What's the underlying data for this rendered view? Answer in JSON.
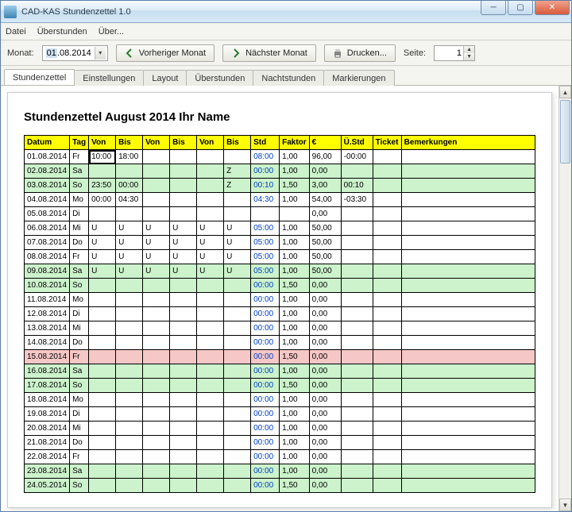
{
  "window": {
    "title": "CAD-KAS Stundenzettel 1.0"
  },
  "menu": {
    "items": [
      "Datei",
      "Überstunden",
      "Über..."
    ]
  },
  "toolbar": {
    "month_label": "Monat:",
    "date_value": "01.08.2014",
    "date_sel": "01",
    "date_rest": ".08.2014",
    "prev": "Vorheriger Monat",
    "next": "Nächster Monat",
    "print": "Drucken...",
    "page_label": "Seite:",
    "page_value": "1"
  },
  "tabs": [
    "Stundenzettel",
    "Einstellungen",
    "Layout",
    "Überstunden",
    "Nachtstunden",
    "Markierungen"
  ],
  "active_tab": 0,
  "sheet": {
    "title": "Stundenzettel August 2014 Ihr Name",
    "columns": [
      "Datum",
      "Tag",
      "Von",
      "Bis",
      "Von",
      "Bis",
      "Von",
      "Bis",
      "Std",
      "Faktor",
      "€",
      "Ü.Std",
      "Ticket",
      "Bemerkungen"
    ],
    "rows": [
      {
        "date": "01.08.2014",
        "tag": "Fr",
        "v1": "10:00",
        "b1": "18:00",
        "v2": "",
        "b2": "",
        "v3": "",
        "b3": "",
        "std": "08:00",
        "f": "1,00",
        "eur": "96,00",
        "us": "-00:00",
        "tk": "",
        "bem": "",
        "cls": "",
        "editing": "v1"
      },
      {
        "date": "02.08.2014",
        "tag": "Sa",
        "v1": "",
        "b1": "",
        "v2": "",
        "b2": "",
        "v3": "",
        "b3": "Z",
        "std": "00:00",
        "f": "1,00",
        "eur": "0,00",
        "us": "",
        "tk": "",
        "bem": "",
        "cls": "green"
      },
      {
        "date": "03.08.2014",
        "tag": "So",
        "v1": "23:50",
        "b1": "00:00",
        "v2": "",
        "b2": "",
        "v3": "",
        "b3": "Z",
        "std": "00:10",
        "f": "1,50",
        "eur": "3,00",
        "us": "00:10",
        "tk": "",
        "bem": "",
        "cls": "green"
      },
      {
        "date": "04.08.2014",
        "tag": "Mo",
        "v1": "00:00",
        "b1": "04:30",
        "v2": "",
        "b2": "",
        "v3": "",
        "b3": "",
        "std": "04:30",
        "f": "1,00",
        "eur": "54,00",
        "us": "-03:30",
        "tk": "",
        "bem": "",
        "cls": ""
      },
      {
        "date": "05.08.2014",
        "tag": "Di",
        "v1": "",
        "b1": "",
        "v2": "",
        "b2": "",
        "v3": "",
        "b3": "",
        "std": "",
        "f": "",
        "eur": "0,00",
        "us": "",
        "tk": "",
        "bem": "",
        "cls": ""
      },
      {
        "date": "06.08.2014",
        "tag": "Mi",
        "v1": "U",
        "b1": "U",
        "v2": "U",
        "b2": "U",
        "v3": "U",
        "b3": "U",
        "std": "05:00",
        "f": "1,00",
        "eur": "50,00",
        "us": "",
        "tk": "",
        "bem": "",
        "cls": ""
      },
      {
        "date": "07.08.2014",
        "tag": "Do",
        "v1": "U",
        "b1": "U",
        "v2": "U",
        "b2": "U",
        "v3": "U",
        "b3": "U",
        "std": "05:00",
        "f": "1,00",
        "eur": "50,00",
        "us": "",
        "tk": "",
        "bem": "",
        "cls": ""
      },
      {
        "date": "08.08.2014",
        "tag": "Fr",
        "v1": "U",
        "b1": "U",
        "v2": "U",
        "b2": "U",
        "v3": "U",
        "b3": "U",
        "std": "05:00",
        "f": "1,00",
        "eur": "50,00",
        "us": "",
        "tk": "",
        "bem": "",
        "cls": ""
      },
      {
        "date": "09.08.2014",
        "tag": "Sa",
        "v1": "U",
        "b1": "U",
        "v2": "U",
        "b2": "U",
        "v3": "U",
        "b3": "U",
        "std": "05:00",
        "f": "1,00",
        "eur": "50,00",
        "us": "",
        "tk": "",
        "bem": "",
        "cls": "green"
      },
      {
        "date": "10.08.2014",
        "tag": "So",
        "v1": "",
        "b1": "",
        "v2": "",
        "b2": "",
        "v3": "",
        "b3": "",
        "std": "00:00",
        "f": "1,50",
        "eur": "0,00",
        "us": "",
        "tk": "",
        "bem": "",
        "cls": "green"
      },
      {
        "date": "11.08.2014",
        "tag": "Mo",
        "v1": "",
        "b1": "",
        "v2": "",
        "b2": "",
        "v3": "",
        "b3": "",
        "std": "00:00",
        "f": "1,00",
        "eur": "0,00",
        "us": "",
        "tk": "",
        "bem": "",
        "cls": ""
      },
      {
        "date": "12.08.2014",
        "tag": "Di",
        "v1": "",
        "b1": "",
        "v2": "",
        "b2": "",
        "v3": "",
        "b3": "",
        "std": "00:00",
        "f": "1,00",
        "eur": "0,00",
        "us": "",
        "tk": "",
        "bem": "",
        "cls": ""
      },
      {
        "date": "13.08.2014",
        "tag": "Mi",
        "v1": "",
        "b1": "",
        "v2": "",
        "b2": "",
        "v3": "",
        "b3": "",
        "std": "00:00",
        "f": "1,00",
        "eur": "0,00",
        "us": "",
        "tk": "",
        "bem": "",
        "cls": ""
      },
      {
        "date": "14.08.2014",
        "tag": "Do",
        "v1": "",
        "b1": "",
        "v2": "",
        "b2": "",
        "v3": "",
        "b3": "",
        "std": "00:00",
        "f": "1,00",
        "eur": "0,00",
        "us": "",
        "tk": "",
        "bem": "",
        "cls": ""
      },
      {
        "date": "15.08.2014",
        "tag": "Fr",
        "v1": "",
        "b1": "",
        "v2": "",
        "b2": "",
        "v3": "",
        "b3": "",
        "std": "00:00",
        "f": "1,50",
        "eur": "0,00",
        "us": "",
        "tk": "",
        "bem": "",
        "cls": "pink"
      },
      {
        "date": "16.08.2014",
        "tag": "Sa",
        "v1": "",
        "b1": "",
        "v2": "",
        "b2": "",
        "v3": "",
        "b3": "",
        "std": "00:00",
        "f": "1,00",
        "eur": "0,00",
        "us": "",
        "tk": "",
        "bem": "",
        "cls": "green"
      },
      {
        "date": "17.08.2014",
        "tag": "So",
        "v1": "",
        "b1": "",
        "v2": "",
        "b2": "",
        "v3": "",
        "b3": "",
        "std": "00:00",
        "f": "1,50",
        "eur": "0,00",
        "us": "",
        "tk": "",
        "bem": "",
        "cls": "green"
      },
      {
        "date": "18.08.2014",
        "tag": "Mo",
        "v1": "",
        "b1": "",
        "v2": "",
        "b2": "",
        "v3": "",
        "b3": "",
        "std": "00:00",
        "f": "1,00",
        "eur": "0,00",
        "us": "",
        "tk": "",
        "bem": "",
        "cls": ""
      },
      {
        "date": "19.08.2014",
        "tag": "Di",
        "v1": "",
        "b1": "",
        "v2": "",
        "b2": "",
        "v3": "",
        "b3": "",
        "std": "00:00",
        "f": "1,00",
        "eur": "0,00",
        "us": "",
        "tk": "",
        "bem": "",
        "cls": ""
      },
      {
        "date": "20.08.2014",
        "tag": "Mi",
        "v1": "",
        "b1": "",
        "v2": "",
        "b2": "",
        "v3": "",
        "b3": "",
        "std": "00:00",
        "f": "1,00",
        "eur": "0,00",
        "us": "",
        "tk": "",
        "bem": "",
        "cls": ""
      },
      {
        "date": "21.08.2014",
        "tag": "Do",
        "v1": "",
        "b1": "",
        "v2": "",
        "b2": "",
        "v3": "",
        "b3": "",
        "std": "00:00",
        "f": "1,00",
        "eur": "0,00",
        "us": "",
        "tk": "",
        "bem": "",
        "cls": ""
      },
      {
        "date": "22.08.2014",
        "tag": "Fr",
        "v1": "",
        "b1": "",
        "v2": "",
        "b2": "",
        "v3": "",
        "b3": "",
        "std": "00:00",
        "f": "1,00",
        "eur": "0,00",
        "us": "",
        "tk": "",
        "bem": "",
        "cls": ""
      },
      {
        "date": "23.08.2014",
        "tag": "Sa",
        "v1": "",
        "b1": "",
        "v2": "",
        "b2": "",
        "v3": "",
        "b3": "",
        "std": "00:00",
        "f": "1,00",
        "eur": "0,00",
        "us": "",
        "tk": "",
        "bem": "",
        "cls": "green"
      },
      {
        "date": "24.05.2014",
        "tag": "So",
        "v1": "",
        "b1": "",
        "v2": "",
        "b2": "",
        "v3": "",
        "b3": "",
        "std": "00:00",
        "f": "1,50",
        "eur": "0,00",
        "us": "",
        "tk": "",
        "bem": "",
        "cls": "green"
      }
    ]
  }
}
